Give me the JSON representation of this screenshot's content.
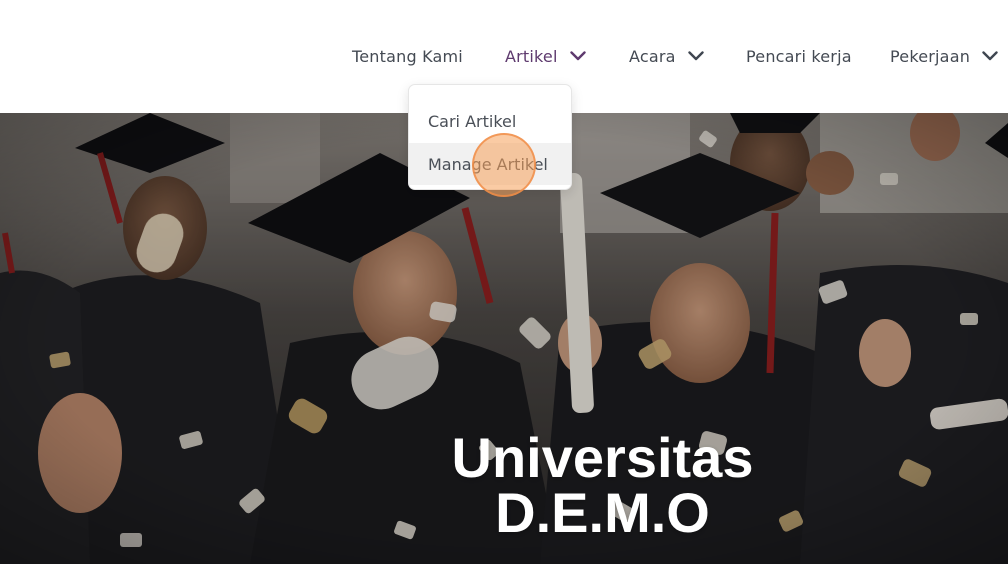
{
  "nav": {
    "items": [
      {
        "label": "Tentang Kami",
        "has_dropdown": false
      },
      {
        "label": "Artikel",
        "has_dropdown": true,
        "active": true
      },
      {
        "label": "Acara",
        "has_dropdown": true
      },
      {
        "label": "Pencari kerja",
        "has_dropdown": false
      },
      {
        "label": "Pekerjaan",
        "has_dropdown": true
      }
    ],
    "icons": {
      "dropdown": "chevron-down-icon"
    }
  },
  "dropdown": {
    "items": [
      {
        "label": "Cari Artikel"
      },
      {
        "label": "Manage Artikel",
        "hovered": true
      }
    ]
  },
  "hero": {
    "title_line1": "Universitas",
    "title_line2": "D.E.M.O",
    "image": "graduation celebration photo with confetti"
  },
  "colors": {
    "active_nav": "#5e3a6e",
    "nav_text": "#444a53",
    "click_indicator": "#f5a05a"
  }
}
